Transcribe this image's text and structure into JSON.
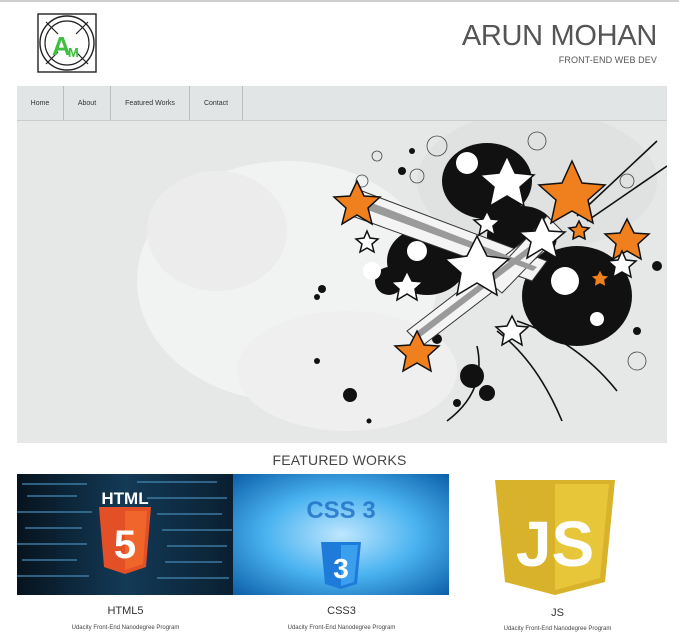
{
  "header": {
    "logo_text": "AM",
    "title": "ARUN MOHAN",
    "subtitle": "FRONT-END WEB DEV"
  },
  "nav": {
    "items": [
      {
        "label": "Home"
      },
      {
        "label": "About"
      },
      {
        "label": "Featured Works"
      },
      {
        "label": "Contact"
      }
    ]
  },
  "section": {
    "title": "FEATURED WORKS"
  },
  "works": [
    {
      "name": "HTML5",
      "thumb_text": "HTML",
      "badge": "5",
      "description": "Udacity Front-End Nanodegree Program"
    },
    {
      "name": "CSS3",
      "thumb_text": "CSS 3",
      "badge": "3",
      "description": "Udacity Front-End Nanodegree Program"
    },
    {
      "name": "JS",
      "thumb_text": "JS",
      "description": "Udacity Front-End Nanodegree Program"
    }
  ],
  "colors": {
    "accent_orange": "#f0801e",
    "html5_orange": "#e34f26",
    "css3_blue": "#1f7bd9",
    "js_yellow": "#d8b22a",
    "nav_bg": "#e2e5e5"
  }
}
